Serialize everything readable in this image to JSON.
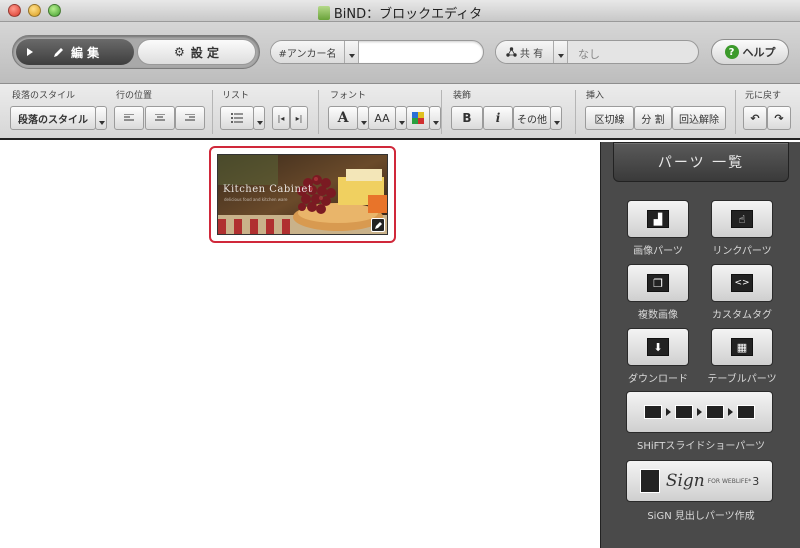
{
  "window": {
    "title": "BiND：ブロックエディタ"
  },
  "toolbar": {
    "mode_edit": "編 集",
    "mode_settings": "設 定",
    "anchor_label": "#アンカー名",
    "anchor_value": "",
    "share_label": "共 有",
    "share_value": "なし",
    "help": "ヘルプ"
  },
  "format": {
    "paragraph_style_label": "段落のスタイル",
    "paragraph_style_button": "段落のスタイル",
    "line_position_label": "行の位置",
    "list_label": "リスト",
    "font_label": "フォント",
    "decoration_label": "装飾",
    "bold": "B",
    "italic": "i",
    "other": "その他",
    "insert_label": "挿入",
    "section_cut": "区切線",
    "split": "分 割",
    "wrap_release": "回込解除",
    "undo_label": "元に戻す",
    "font_a": "A",
    "font_aa": "AA"
  },
  "canvas": {
    "image_title": "Kitchen Cabinet",
    "image_subtitle": "delicious food and kitchen ware"
  },
  "parts_panel": {
    "header": "パーツ 一覧",
    "items": [
      {
        "label": "画像パーツ",
        "icon": "image-icon"
      },
      {
        "label": "リンクパーツ",
        "icon": "hand-pointer-icon"
      },
      {
        "label": "複数画像",
        "icon": "multi-image-icon"
      },
      {
        "label": "カスタムタグ",
        "icon": "code-tag-icon"
      },
      {
        "label": "ダウンロード",
        "icon": "download-icon"
      },
      {
        "label": "テーブルパーツ",
        "icon": "table-icon"
      }
    ],
    "shift_label": "SHiFTスライドショーパーツ",
    "sign_label": "SiGN 見出しパーツ作成",
    "sign_logo": "Sign",
    "sign_sub": "FOR WEBLIFE*",
    "sign_num": "3"
  }
}
